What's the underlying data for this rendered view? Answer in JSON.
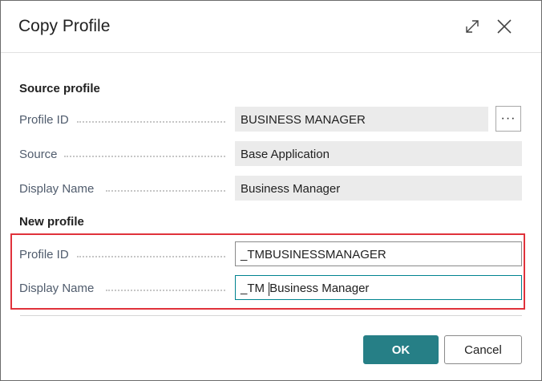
{
  "dialog": {
    "title": "Copy Profile",
    "expand_icon": "expand-icon",
    "close_icon": "close-icon"
  },
  "source_profile": {
    "heading": "Source profile",
    "fields": [
      {
        "label": "Profile ID",
        "value": "BUSINESS MANAGER"
      },
      {
        "label": "Source",
        "value": "Base Application"
      },
      {
        "label": "Display Name",
        "value": "Business Manager"
      }
    ],
    "lookup_label": "···"
  },
  "new_profile": {
    "heading": "New profile",
    "fields": [
      {
        "label": "Profile ID",
        "value": "_TMBUSINESSMANAGER"
      },
      {
        "label": "Display Name",
        "value_before_caret": "_TM ",
        "value_after_caret": "Business Manager"
      }
    ]
  },
  "buttons": {
    "ok": "OK",
    "cancel": "Cancel"
  },
  "colors": {
    "accent": "#267f86",
    "highlight_border": "#e0323b"
  }
}
